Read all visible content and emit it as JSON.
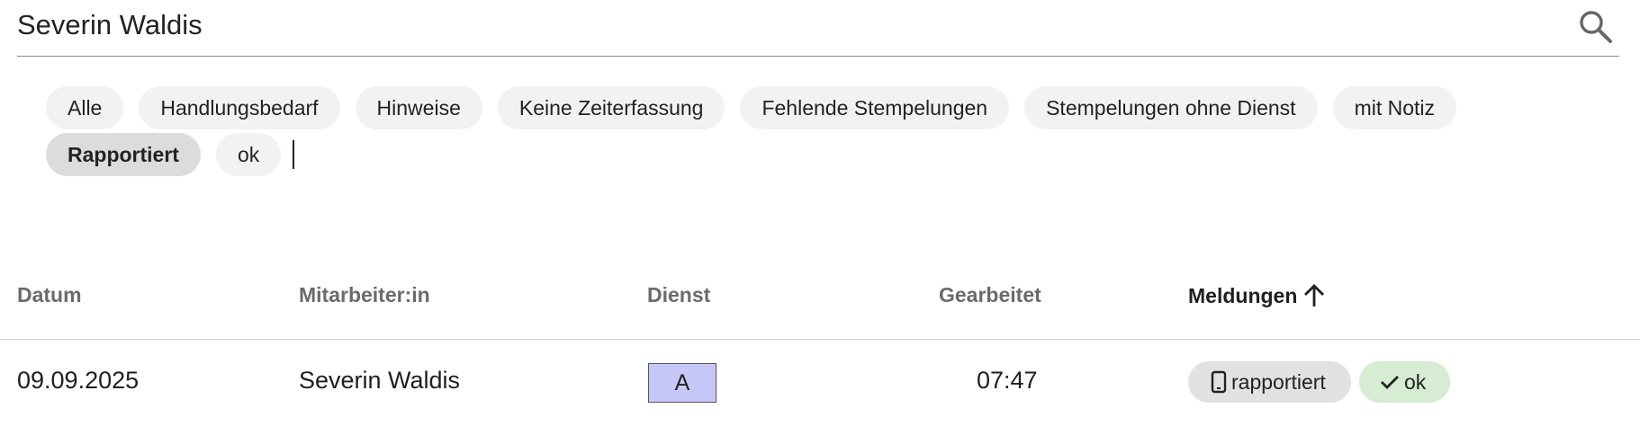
{
  "search": {
    "value": "Severin Waldis",
    "icon": "search-icon"
  },
  "filters": {
    "row1": [
      {
        "label": "Alle"
      },
      {
        "label": "Handlungsbedarf"
      },
      {
        "label": "Hinweise"
      },
      {
        "label": "Keine Zeiterfassung"
      },
      {
        "label": "Fehlende Stempelungen"
      },
      {
        "label": "Stempelungen ohne Dienst"
      },
      {
        "label": "mit Notiz"
      }
    ],
    "row2": [
      {
        "label": "Rapportiert",
        "selected": true
      },
      {
        "label": "ok"
      }
    ]
  },
  "table": {
    "columns": {
      "datum": "Datum",
      "mitarbeiter": "Mitarbeiter:in",
      "dienst": "Dienst",
      "gearbeitet": "Gearbeitet",
      "meldungen": "Meldungen"
    },
    "sort_icon": "arrow-up-icon",
    "rows": [
      {
        "datum": "09.09.2025",
        "mitarbeiter": "Severin Waldis",
        "dienst": "A",
        "dienst_color": "#c8c8f8",
        "gearbeitet": "07:47",
        "badges": [
          {
            "label": "rapportiert",
            "icon": "phone-icon",
            "color": "#e2e2e2"
          },
          {
            "label": "ok",
            "icon": "check-icon",
            "color": "#d6ecd3"
          }
        ]
      }
    ]
  }
}
